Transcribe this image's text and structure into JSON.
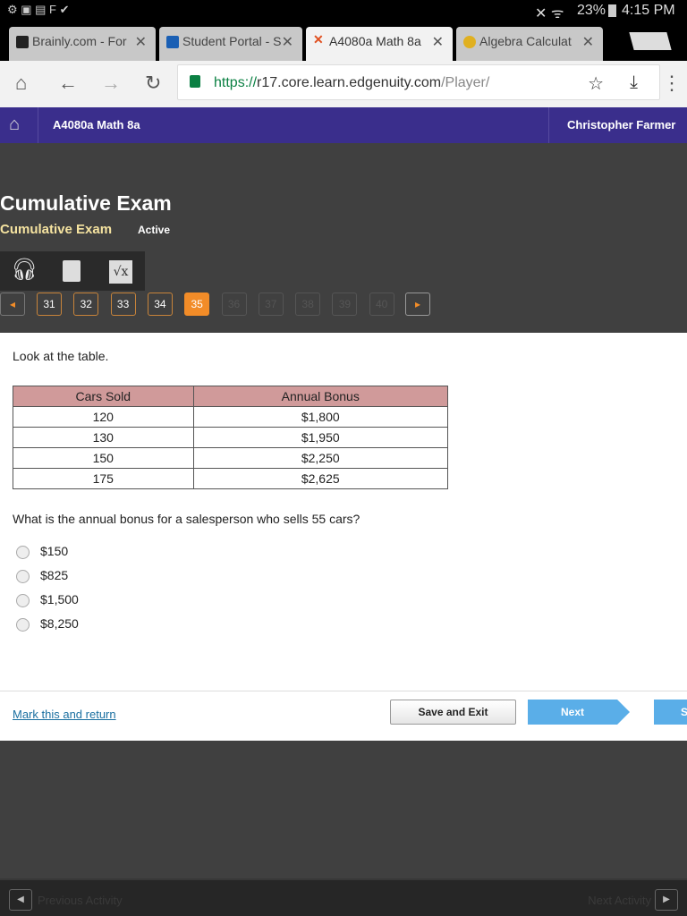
{
  "status_bar": {
    "battery": "23%",
    "time": "4:15 PM"
  },
  "tabs": [
    {
      "label": "Brainly.com - For",
      "active": false
    },
    {
      "label": "Student Portal - S",
      "active": false
    },
    {
      "label": "A4080a Math 8a",
      "active": true
    },
    {
      "label": "Algebra Calculat",
      "active": false
    }
  ],
  "url": {
    "scheme": "https://",
    "host": "r17.core.learn.edgenuity.com",
    "path": "/Player/"
  },
  "header": {
    "course": "A4080a Math 8a",
    "user": "Christopher Farmer"
  },
  "exam": {
    "title": "Cumulative Exam",
    "subtitle": "Cumulative Exam",
    "status": "Active"
  },
  "tools": [
    "headphones-icon",
    "calculator-icon",
    "formula-icon"
  ],
  "questions": [
    {
      "n": "31",
      "state": "done"
    },
    {
      "n": "32",
      "state": "done"
    },
    {
      "n": "33",
      "state": "done"
    },
    {
      "n": "34",
      "state": "done"
    },
    {
      "n": "35",
      "state": "current"
    },
    {
      "n": "36",
      "state": "disabled"
    },
    {
      "n": "37",
      "state": "disabled"
    },
    {
      "n": "38",
      "state": "disabled"
    },
    {
      "n": "39",
      "state": "disabled"
    },
    {
      "n": "40",
      "state": "disabled"
    }
  ],
  "question": {
    "intro": "Look at the table.",
    "table": {
      "headers": [
        "Cars Sold",
        "Annual Bonus"
      ],
      "rows": [
        [
          "120",
          "$1,800"
        ],
        [
          "130",
          "$1,950"
        ],
        [
          "150",
          "$2,250"
        ],
        [
          "175",
          "$2,625"
        ]
      ]
    },
    "prompt": "What is the annual bonus for a salesperson who sells 55 cars?",
    "options": [
      "$150",
      "$825",
      "$1,500",
      "$8,250"
    ]
  },
  "actions": {
    "mark": "Mark this and return",
    "save": "Save and Exit",
    "next": "Next",
    "submit": "S"
  },
  "footer": {
    "prev": "Previous Activity",
    "next": "Next Activity"
  },
  "colors": {
    "header": "#3a2e8c",
    "accent": "#f28c28",
    "next_button": "#5aaee8"
  }
}
